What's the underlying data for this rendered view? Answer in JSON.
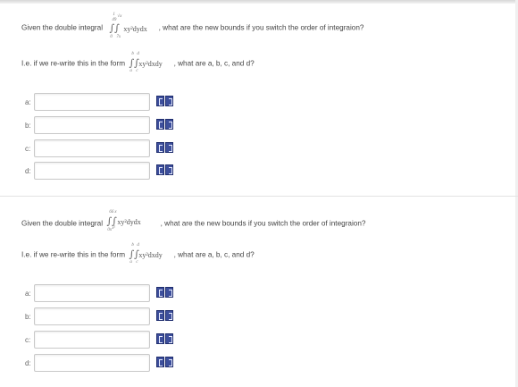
{
  "questions": [
    {
      "prompt_pre": "Given the double integral",
      "prompt_post": ", what are the new bounds if you switch the order of integraion?",
      "integral": {
        "outer_upper": "1",
        "outer_lower": "0",
        "inner_upper": "√x",
        "inner_lower": "7x",
        "outer_upper_denom": "49",
        "integrand": "xy²dydx"
      },
      "hint_pre": "I.e. if we re-write this in the form",
      "hint_post": ", what are a, b, c, and d?",
      "hint_form": {
        "outer_upper": "b",
        "outer_lower": "a",
        "inner_upper": "d",
        "inner_lower": "c",
        "integrand": "xy²dxdy"
      },
      "fields": [
        {
          "label": "a:",
          "value": ""
        },
        {
          "label": "b:",
          "value": ""
        },
        {
          "label": "c:",
          "value": ""
        },
        {
          "label": "d:",
          "value": ""
        }
      ]
    },
    {
      "prompt_pre": "Given the double integral",
      "prompt_post": ", what are the new bounds if you switch the order of integraion?",
      "integral": {
        "outer_upper": "66",
        "outer_lower": "0",
        "inner_upper": "x",
        "inner_lower": "x²",
        "outer_upper_denom": "",
        "integrand": "xy²dydx",
        "inner_lower_extra": "0x"
      },
      "hint_pre": "I.e. if we re-write this in the form",
      "hint_post": ", what are a, b, c, and d?",
      "hint_form": {
        "outer_upper": "b",
        "outer_lower": "a",
        "inner_upper": "d",
        "inner_lower": "c",
        "integrand": "xy²dxdy"
      },
      "fields": [
        {
          "label": "a:",
          "value": ""
        },
        {
          "label": "b:",
          "value": ""
        },
        {
          "label": "c:",
          "value": ""
        },
        {
          "label": "d:",
          "value": ""
        }
      ]
    }
  ],
  "icons": {
    "tool1": "equation-editor-icon",
    "tool2": "help-icon"
  }
}
